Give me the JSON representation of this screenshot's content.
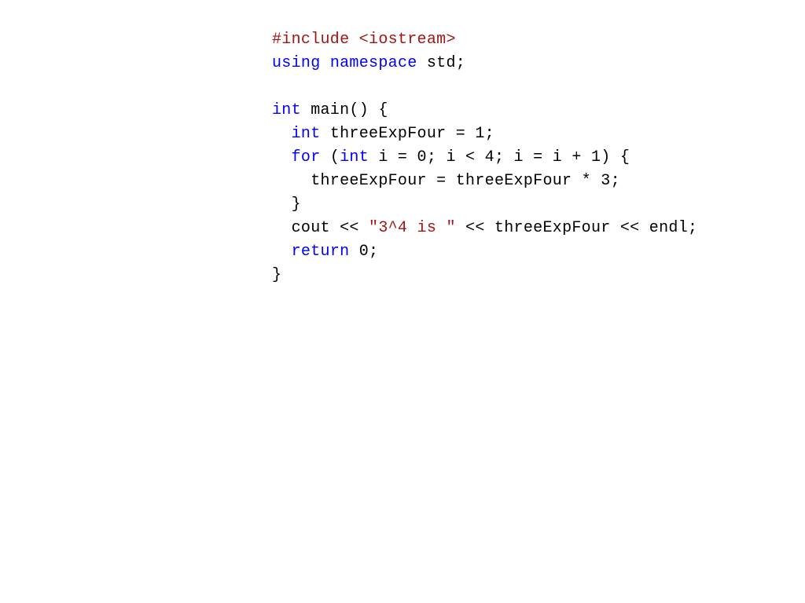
{
  "code": {
    "line1": {
      "include": "#include",
      "header": "<iostream>"
    },
    "line2": {
      "using": "using",
      "namespace": "namespace",
      "rest": " std;"
    },
    "line3": {
      "blank": ""
    },
    "line4": {
      "type": "int",
      "rest": " main() {"
    },
    "line5": {
      "indent": "  ",
      "type": "int",
      "rest": " threeExpFour = 1;"
    },
    "line6": {
      "indent": "  ",
      "for": "for",
      "open": " (",
      "type": "int",
      "rest": " i = 0; i < 4; i = i + 1) {"
    },
    "line7": {
      "body": "    threeExpFour = threeExpFour * 3;"
    },
    "line8": {
      "body": "  }"
    },
    "line9": {
      "indent": "  cout << ",
      "str": "\"3^4 is \"",
      "rest": " << threeExpFour << endl;"
    },
    "line10": {
      "indent": "  ",
      "ret": "return",
      "rest": " 0;"
    },
    "line11": {
      "body": "}"
    }
  },
  "colors": {
    "keyword": "#0000ff",
    "string": "#a31515",
    "preproc": "#a31515",
    "plain": "#000000"
  }
}
